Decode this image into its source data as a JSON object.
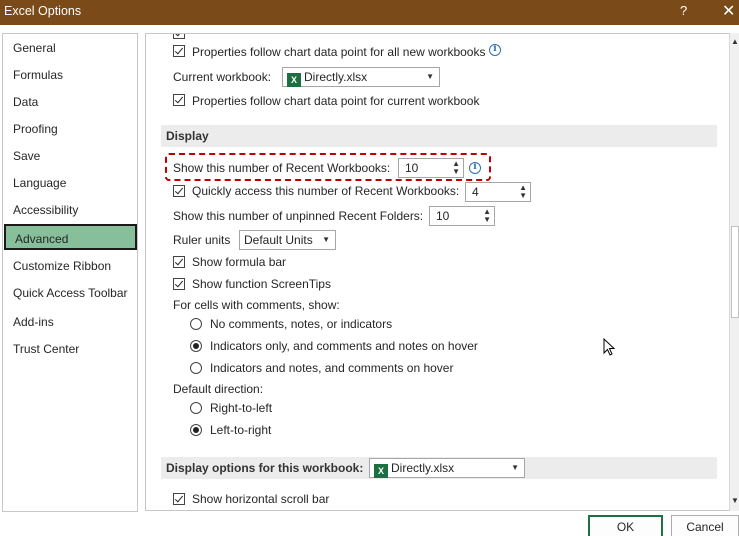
{
  "window": {
    "title": "Excel Options",
    "help": "?",
    "close": "✕"
  },
  "nav": {
    "items": [
      {
        "label": "General"
      },
      {
        "label": "Formulas"
      },
      {
        "label": "Data"
      },
      {
        "label": "Proofing"
      },
      {
        "label": "Save"
      },
      {
        "label": "Language"
      },
      {
        "label": "Accessibility"
      },
      {
        "label": "Advanced"
      },
      {
        "label": "Customize Ribbon"
      },
      {
        "label": "Quick Access Toolbar"
      },
      {
        "label": "Add-ins"
      },
      {
        "label": "Trust Center"
      }
    ],
    "active": "Advanced"
  },
  "chart_opts": {
    "props_all_new": "Properties follow chart data point for all new workbooks",
    "current_workbook_label": "Current workbook:",
    "current_workbook_value": "Directly.xlsx",
    "props_current": "Properties follow chart data point for current workbook"
  },
  "display": {
    "header": "Display",
    "recent_workbooks_label": "Show this number of Recent Workbooks:",
    "recent_workbooks_value": "10",
    "quick_access_label": "Quickly access this number of Recent Workbooks:",
    "quick_access_value": "4",
    "unpinned_folders_label": "Show this number of unpinned Recent Folders:",
    "unpinned_folders_value": "10",
    "ruler_units_label": "Ruler units",
    "ruler_units_value": "Default Units",
    "show_formula_bar": "Show formula bar",
    "show_screentips": "Show function ScreenTips",
    "comments_label": "For cells with comments, show:",
    "comment_options": [
      "No comments, notes, or indicators",
      "Indicators only, and comments and notes on hover",
      "Indicators and notes, and comments on hover"
    ],
    "default_direction_label": "Default direction:",
    "direction_options": [
      "Right-to-left",
      "Left-to-right"
    ]
  },
  "workbook_display": {
    "header": "Display options for this workbook:",
    "workbook_value": "Directly.xlsx",
    "show_hscroll": "Show horizontal scroll bar"
  },
  "buttons": {
    "ok": "OK",
    "cancel": "Cancel"
  },
  "icons": {
    "excel": "X",
    "info": "i"
  },
  "colors": {
    "titlebar": "#7a4a18",
    "active_nav": "#86bf9a",
    "highlight": "#c00000",
    "excel_green": "#1d6f42"
  }
}
